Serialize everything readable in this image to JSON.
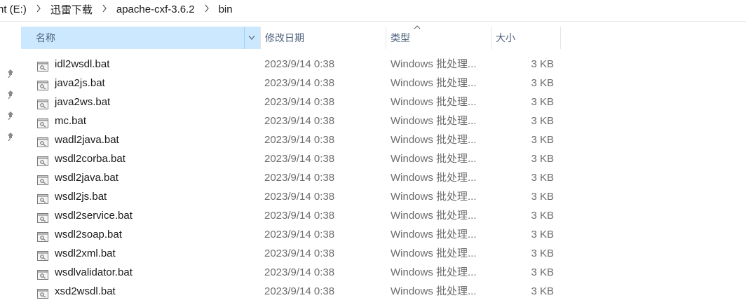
{
  "breadcrumb": {
    "items": [
      "nt (E:)",
      "迅雷下载",
      "apache-cxf-3.6.2",
      "bin"
    ]
  },
  "columns": {
    "name": "名称",
    "date": "修改日期",
    "type": "类型",
    "size": "大小"
  },
  "sort": {
    "column": "type",
    "direction": "ascending"
  },
  "files": [
    {
      "name": "idl2wsdl.bat",
      "date": "2023/9/14 0:38",
      "type": "Windows 批处理...",
      "size": "3 KB"
    },
    {
      "name": "java2js.bat",
      "date": "2023/9/14 0:38",
      "type": "Windows 批处理...",
      "size": "3 KB"
    },
    {
      "name": "java2ws.bat",
      "date": "2023/9/14 0:38",
      "type": "Windows 批处理...",
      "size": "3 KB"
    },
    {
      "name": "mc.bat",
      "date": "2023/9/14 0:38",
      "type": "Windows 批处理...",
      "size": "3 KB"
    },
    {
      "name": "wadl2java.bat",
      "date": "2023/9/14 0:38",
      "type": "Windows 批处理...",
      "size": "3 KB"
    },
    {
      "name": "wsdl2corba.bat",
      "date": "2023/9/14 0:38",
      "type": "Windows 批处理...",
      "size": "3 KB"
    },
    {
      "name": "wsdl2java.bat",
      "date": "2023/9/14 0:38",
      "type": "Windows 批处理...",
      "size": "3 KB"
    },
    {
      "name": "wsdl2js.bat",
      "date": "2023/9/14 0:38",
      "type": "Windows 批处理...",
      "size": "3 KB"
    },
    {
      "name": "wsdl2service.bat",
      "date": "2023/9/14 0:38",
      "type": "Windows 批处理...",
      "size": "3 KB"
    },
    {
      "name": "wsdl2soap.bat",
      "date": "2023/9/14 0:38",
      "type": "Windows 批处理...",
      "size": "3 KB"
    },
    {
      "name": "wsdl2xml.bat",
      "date": "2023/9/14 0:38",
      "type": "Windows 批处理...",
      "size": "3 KB"
    },
    {
      "name": "wsdlvalidator.bat",
      "date": "2023/9/14 0:38",
      "type": "Windows 批处理...",
      "size": "3 KB"
    },
    {
      "name": "xsd2wsdl.bat",
      "date": "2023/9/14 0:38",
      "type": "Windows 批处理...",
      "size": "3 KB"
    }
  ],
  "icons": {
    "file": "batch-file-icon",
    "pin": "pin-icon",
    "separator": "chevron-right-icon",
    "dropdown": "chevron-down-icon",
    "sort": "sort-up-icon"
  },
  "colors": {
    "header_selected_bg": "#cce8ff",
    "header_text": "#4c607a",
    "muted_text": "#6d6d6d"
  }
}
